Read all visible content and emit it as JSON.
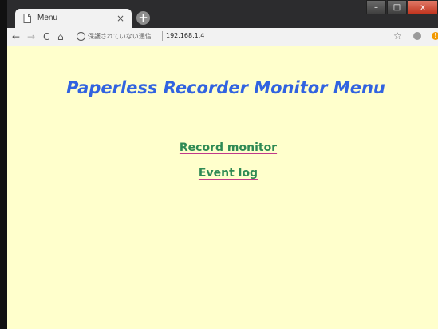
{
  "browser": {
    "tab": {
      "title": "Menu",
      "close_glyph": "×"
    },
    "new_tab_glyph": "+",
    "window_controls": {
      "minimize": "–",
      "maximize": "□",
      "close": "x"
    },
    "nav": {
      "back": "←",
      "forward": "→",
      "reload": "C",
      "home": "⌂"
    },
    "security_icon": "i",
    "security_text": "保護されていない通信",
    "url": "192.168.1.4",
    "bookmark_star": "☆",
    "update_badge": "!"
  },
  "page": {
    "title": "Paperless Recorder Monitor Menu",
    "links": [
      {
        "label": "Record monitor"
      },
      {
        "label": "Event log"
      }
    ]
  },
  "colors": {
    "page_background": "#ffffcc",
    "title": "#3163e0",
    "link": "#2f8a54",
    "link_underline": "#c0398a"
  }
}
